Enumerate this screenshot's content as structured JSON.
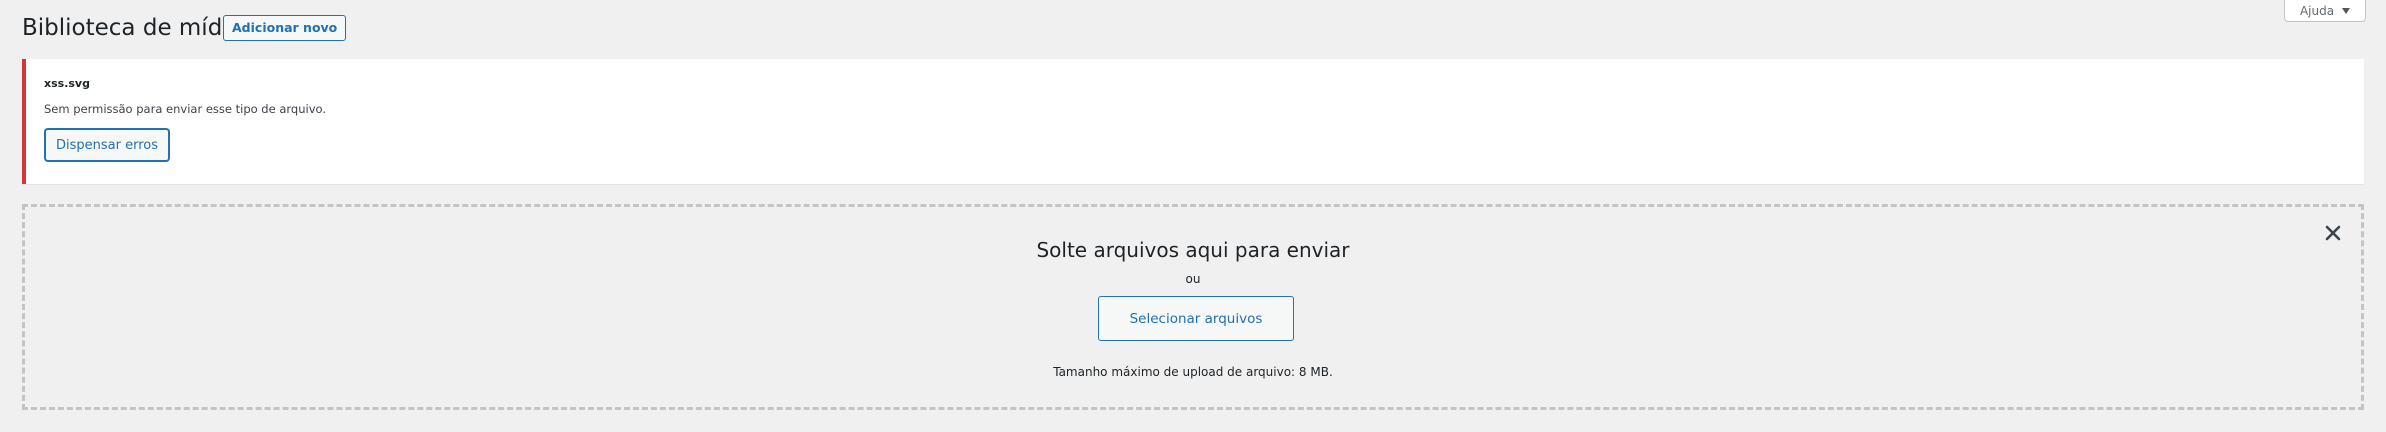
{
  "header": {
    "title": "Biblioteca de mídia",
    "add_new_label": "Adicionar novo"
  },
  "help_tab": {
    "label": "Ajuda",
    "icon": "caret-down-icon"
  },
  "notice": {
    "filename": "xss.svg",
    "message": "Sem permissão para enviar esse tipo de arquivo.",
    "dismiss_label": "Dispensar erros",
    "accent_color": "#d63638"
  },
  "uploader": {
    "title": "Solte arquivos aqui para enviar",
    "or_text": "ou",
    "select_label": "Selecionar arquivos",
    "max_size_text": "Tamanho máximo de upload de arquivo: 8 MB.",
    "close_icon": "close-icon"
  },
  "colors": {
    "accent": "#2271b1",
    "background": "#f0f0f1",
    "error": "#d63638"
  }
}
